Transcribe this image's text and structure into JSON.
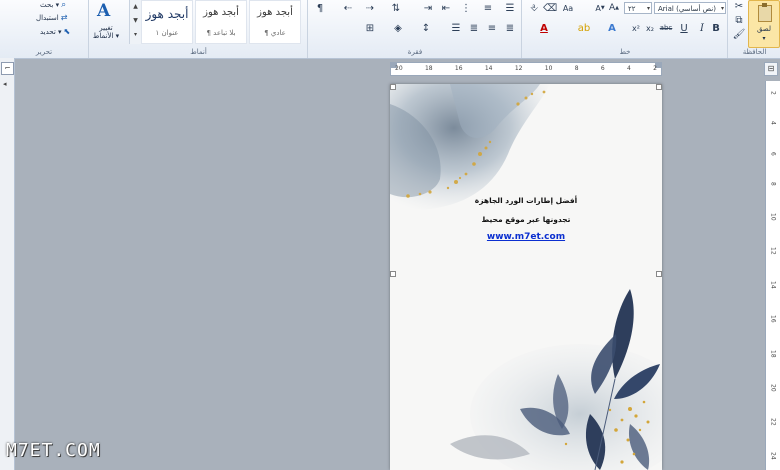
{
  "ribbon": {
    "clipboard": {
      "group_label": "الحافظة",
      "paste_label": "لصق",
      "paste_arrow": "▾"
    },
    "font": {
      "group_label": "خط",
      "font_name": "Arial (نص أساسي)",
      "font_size": "٢٢"
    },
    "paragraph": {
      "group_label": "فقرة"
    },
    "styles": {
      "group_label": "أنماط",
      "tiles": [
        {
          "sample": "أبجد هوز",
          "name": "¶ عادي"
        },
        {
          "sample": "أبجد هوز",
          "name": "¶ بلا تباعد"
        },
        {
          "sample": "أبجد هوز",
          "name": "عنوان ١"
        }
      ],
      "change_styles_label": "تغيير الأنماط ▾"
    },
    "editing": {
      "group_label": "تحرير",
      "find_label": "بحث ▾",
      "replace_label": "استبدال",
      "select_label": "تحديد ▾"
    }
  },
  "ruler": {
    "h_numbers": [
      "20",
      "18",
      "16",
      "14",
      "12",
      "10",
      "8",
      "6",
      "4",
      "2"
    ],
    "v_numbers": [
      "2",
      "4",
      "6",
      "8",
      "10",
      "12",
      "14",
      "16",
      "18",
      "20",
      "22",
      "24"
    ]
  },
  "document": {
    "line1": "أفضل إطارات الورد الجاهزة",
    "line2": "تجدونها عبر موقع محيط",
    "line3": "www.m7et.com"
  },
  "watermark": "M7ET.COM",
  "colors": {
    "ribbon_bg": "#e4ebf4",
    "workspace": "#a9b1bb",
    "link": "#0b2fd0",
    "paste_highlight": "#fbe6a6"
  }
}
